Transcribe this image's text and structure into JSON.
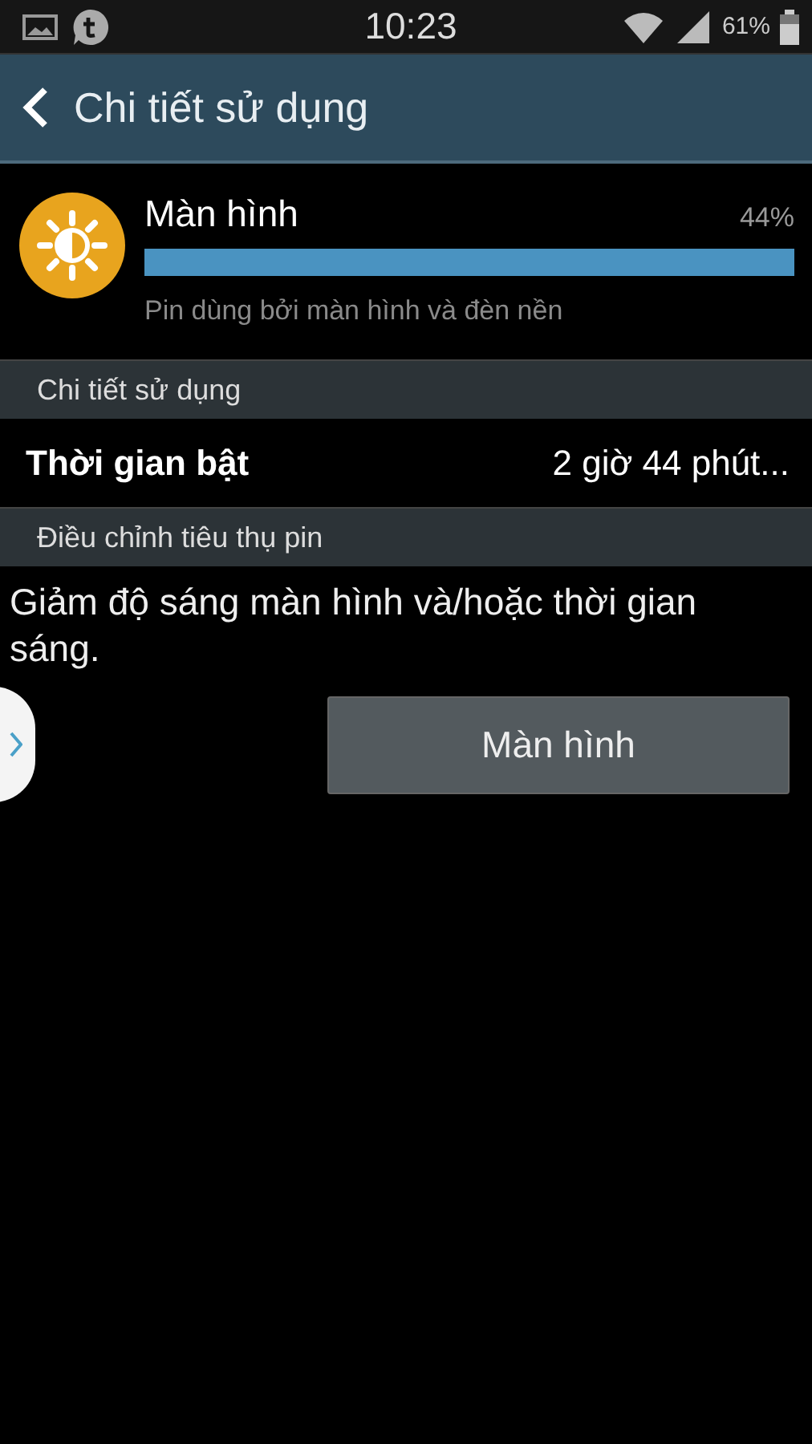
{
  "status_bar": {
    "time": "10:23",
    "battery": "61%"
  },
  "app_bar": {
    "title": "Chi tiết sử dụng"
  },
  "usage": {
    "name": "Màn hình",
    "percent": "44%",
    "level": 1,
    "description": "Pin dùng bởi màn hình và đèn nền"
  },
  "sections": [
    {
      "header": "Chi tiết sử dụng",
      "kind": "rows",
      "rows": [
        {
          "label": "Thời gian bật",
          "value": "2 giờ 44 phút..."
        }
      ]
    },
    {
      "header": "Điều chỉnh tiêu thụ pin",
      "kind": "tip",
      "text": "Giảm độ sáng màn hình và/hoặc thời gian sáng.",
      "button": "Màn hình"
    }
  ]
}
